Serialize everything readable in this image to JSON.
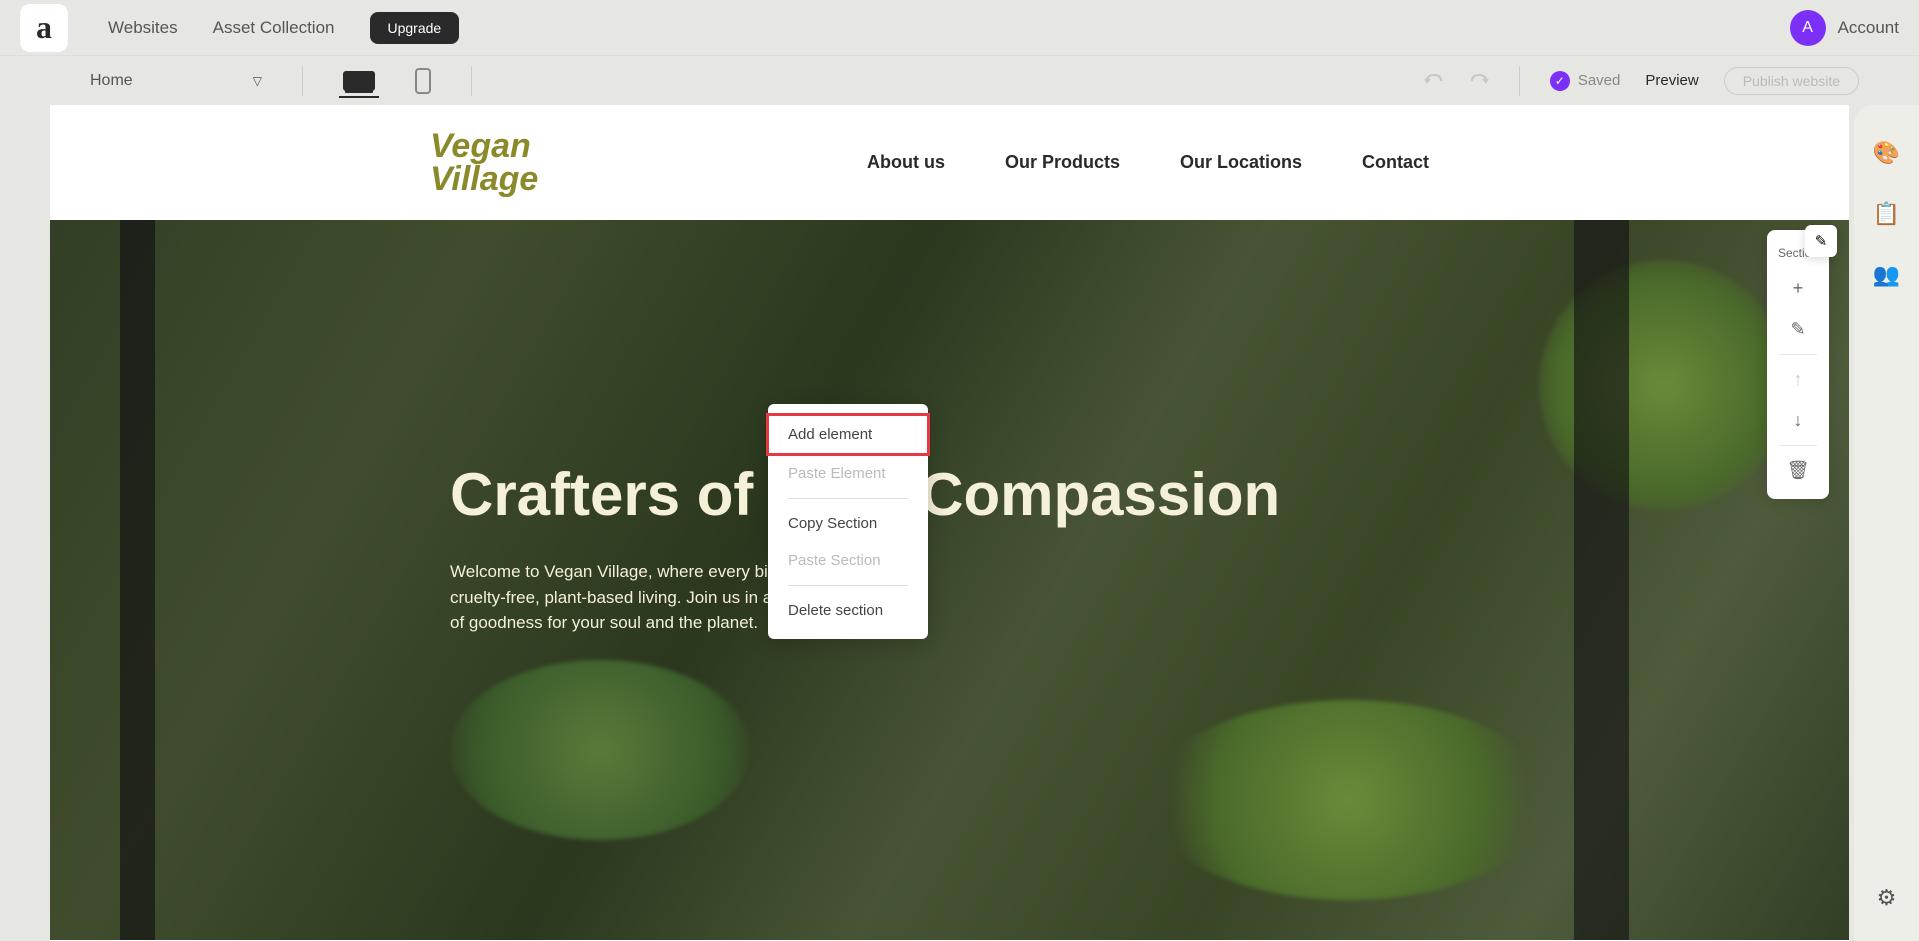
{
  "topbar": {
    "logo": "a",
    "nav": {
      "websites": "Websites",
      "assets": "Asset Collection"
    },
    "upgrade": "Upgrade",
    "account": {
      "initial": "A",
      "label": "Account"
    }
  },
  "editorbar": {
    "page": "Home",
    "saved": "Saved",
    "preview": "Preview",
    "publish": "Publish website"
  },
  "site": {
    "logo_line1": "Vegan",
    "logo_line2": "Village",
    "nav": {
      "about": "About us",
      "products": "Our Products",
      "locations": "Our Locations",
      "contact": "Contact"
    },
    "hero": {
      "title": "Crafters of Pure Compassion",
      "text_l1": "Welcome to Vegan Village, where every bite is a celebration of",
      "text_l2": "cruelty-free, plant-based living. Join us in a culinary journey full",
      "text_l3": "of goodness for your soul and the planet."
    }
  },
  "context_menu": {
    "add_element": "Add element",
    "paste_element": "Paste Element",
    "copy_section": "Copy Section",
    "paste_section": "Paste Section",
    "delete_section": "Delete section"
  },
  "section_panel": {
    "label": "Section"
  },
  "icons": {
    "chevron": "▽",
    "check": "✓",
    "plus": "+",
    "pencil": "✎",
    "arrow_up": "↑",
    "arrow_down": "↓",
    "trash": "🗑",
    "palette": "🎨",
    "clipboard": "📋",
    "people": "👥",
    "gear": "⚙"
  }
}
